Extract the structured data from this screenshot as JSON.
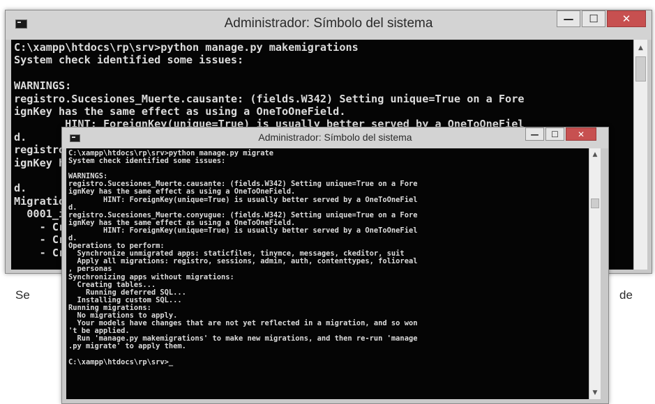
{
  "page": {
    "text_left": "Se",
    "text_right": "de"
  },
  "window_back": {
    "title": "Administrador: Símbolo del sistema",
    "buttons": {
      "minimize": "—",
      "maximize": "☐",
      "close": "✕"
    },
    "console_lines": [
      "C:\\xampp\\htdocs\\rp\\srv>python manage.py makemigrations",
      "System check identified some issues:",
      "",
      "WARNINGS:",
      "registro.Sucesiones_Muerte.causante: (fields.W342) Setting unique=True on a Fore",
      "ignKey has the same effect as using a OneToOneField.",
      "        HINT: ForeignKey(unique=True) is usually better served by a OneToOneFiel",
      "d.",
      "registro.Sucesiones_Muerte.conyugue: (fields.W342) Setting unique=True on a Fore",
      "ignKey has the same effect as using a OneToOneField.",
      "        HINT: ForeignKey(unique=True) is usually better served by a OneToOneFiel",
      "d.",
      "Migrations for 'registro':",
      "  0001_initial.py:",
      "    - Create model Sucesiones",
      "    - Create model Sucesiones_Muerte",
      "    - Create model Sucesiones_Vida"
    ]
  },
  "window_front": {
    "title": "Administrador: Símbolo del sistema",
    "buttons": {
      "minimize": "—",
      "maximize": "☐",
      "close": "✕"
    },
    "console_lines": [
      "C:\\xampp\\htdocs\\rp\\srv>python manage.py migrate",
      "System check identified some issues:",
      "",
      "WARNINGS:",
      "registro.Sucesiones_Muerte.causante: (fields.W342) Setting unique=True on a Fore",
      "ignKey has the same effect as using a OneToOneField.",
      "        HINT: ForeignKey(unique=True) is usually better served by a OneToOneFiel",
      "d.",
      "registro.Sucesiones_Muerte.conyugue: (fields.W342) Setting unique=True on a Fore",
      "ignKey has the same effect as using a OneToOneField.",
      "        HINT: ForeignKey(unique=True) is usually better served by a OneToOneFiel",
      "d.",
      "Operations to perform:",
      "  Synchronize unmigrated apps: staticfiles, tinymce, messages, ckeditor, suit",
      "  Apply all migrations: registro, sessions, admin, auth, contenttypes, folioreal",
      ", personas",
      "Synchronizing apps without migrations:",
      "  Creating tables...",
      "    Running deferred SQL...",
      "  Installing custom SQL...",
      "Running migrations:",
      "  No migrations to apply.",
      "  Your models have changes that are not yet reflected in a migration, and so won",
      "'t be applied.",
      "  Run 'manage.py makemigrations' to make new migrations, and then re-run 'manage",
      ".py migrate' to apply them.",
      "",
      "C:\\xampp\\htdocs\\rp\\srv>_"
    ]
  }
}
